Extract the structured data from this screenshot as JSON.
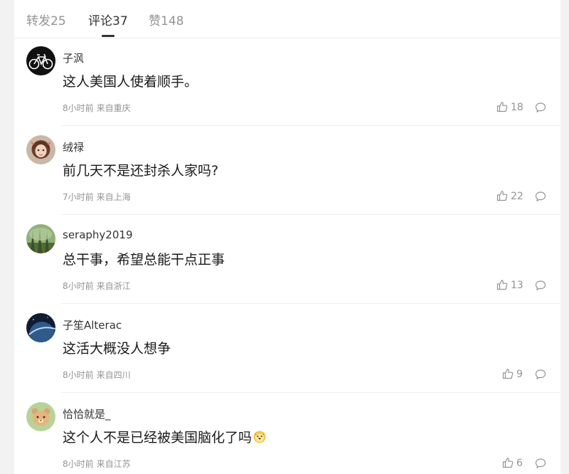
{
  "tabs": [
    {
      "label": "转发25"
    },
    {
      "label": "评论37",
      "active": true
    },
    {
      "label": "赞148"
    }
  ],
  "comments": [
    {
      "user": "子沨",
      "text": "这人美国人使着顺手。",
      "time": "8小时前",
      "location": "来自重庆",
      "likes": "18",
      "avatar": "bicycle-avatar"
    },
    {
      "user": "绒禄",
      "text": "前几天不是还封杀人家吗?",
      "time": "7小时前",
      "location": "来自上海",
      "likes": "22",
      "avatar": "girl-avatar"
    },
    {
      "user": "seraphy2019",
      "text": "总干事，希望总能干点正事",
      "time": "8小时前",
      "location": "来自浙江",
      "likes": "13",
      "avatar": "forest-avatar"
    },
    {
      "user": "子笙Alterac",
      "text": "这活大概没人想争",
      "time": "8小时前",
      "location": "来自四川",
      "likes": "9",
      "avatar": "planet-avatar"
    },
    {
      "user": "恰恰就是_",
      "text": "这个人不是已经被美国脑化了吗",
      "time": "8小时前",
      "location": "来自江苏",
      "likes": "6",
      "avatar": "bear-avatar",
      "emoji": "doge-emoji"
    }
  ],
  "colors": {
    "accent": "#333333",
    "muted": "#939393",
    "divider": "#eeeeee",
    "background": "#f2f2f2"
  }
}
